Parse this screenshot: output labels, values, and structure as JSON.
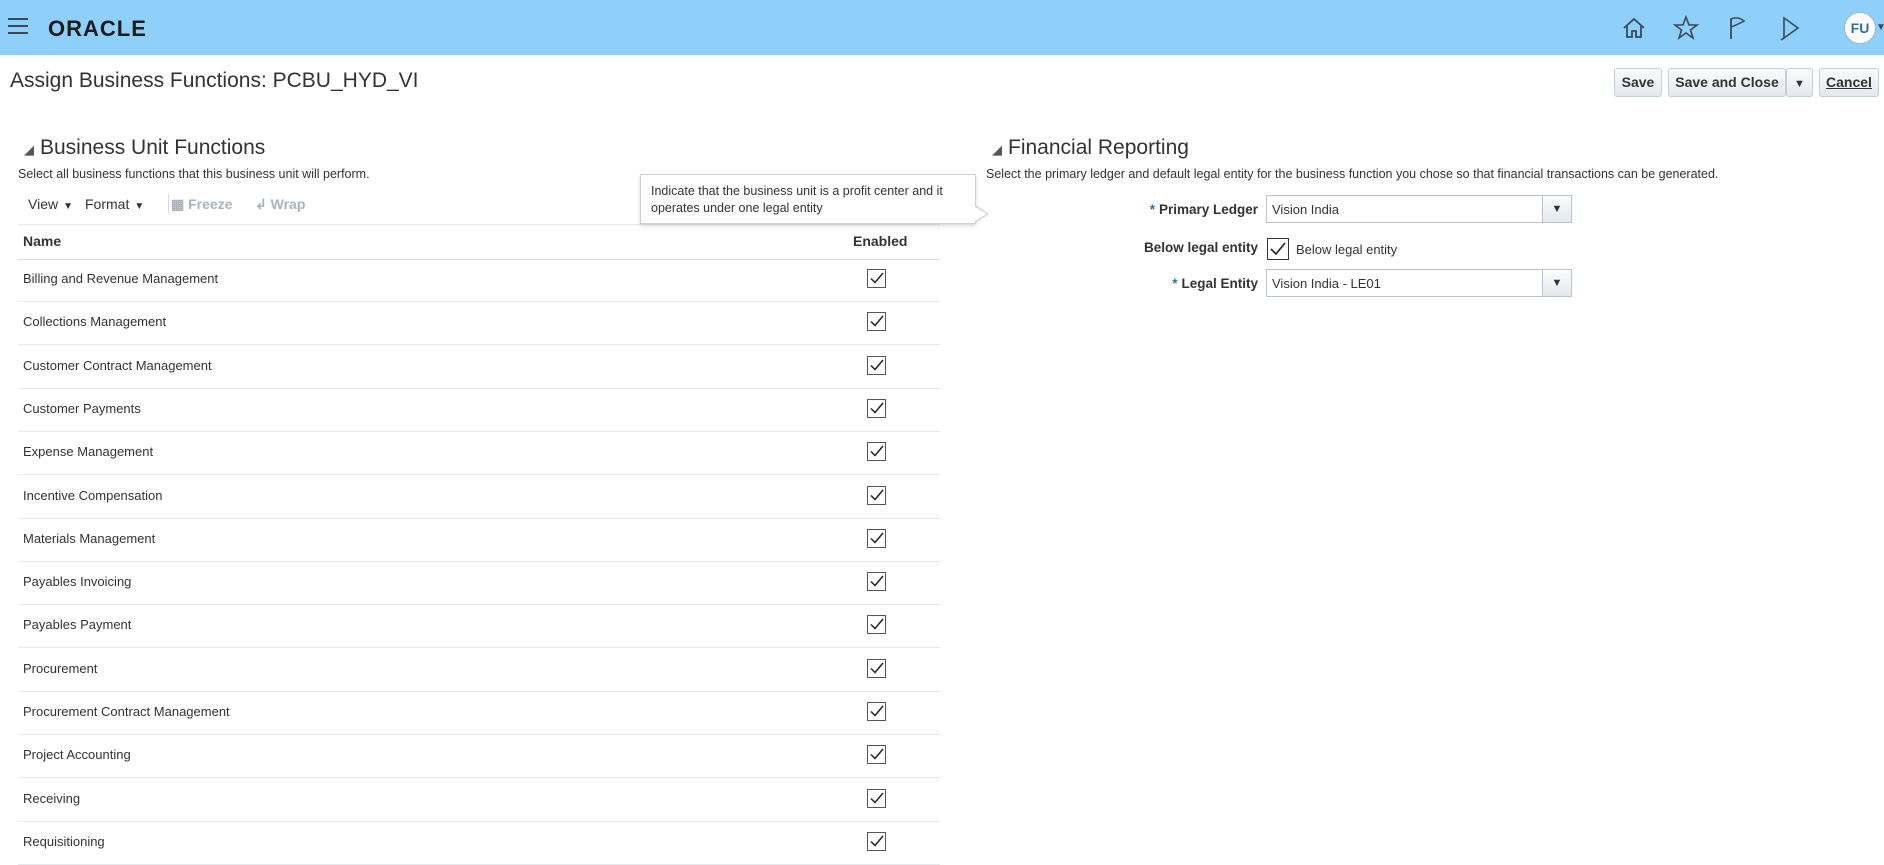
{
  "header": {
    "logo": "ORACLE",
    "icons": [
      "home-icon",
      "star-icon",
      "flag-icon",
      "play-icon"
    ],
    "avatar": "FU"
  },
  "page": {
    "title": "Assign Business Functions: PCBU_HYD_VI",
    "buttons": {
      "save": "Save",
      "save_close": "Save and Close",
      "cancel": "Cancel"
    }
  },
  "buf": {
    "heading": "Business Unit Functions",
    "description": "Select all business functions that this business unit will perform.",
    "toolbar": {
      "view": "View",
      "format": "Format",
      "freeze": "Freeze",
      "wrap": "Wrap"
    },
    "columns": {
      "name": "Name",
      "enabled": "Enabled"
    },
    "rows": [
      {
        "name": "Billing and Revenue Management",
        "enabled": true
      },
      {
        "name": "Collections Management",
        "enabled": true
      },
      {
        "name": "Customer Contract Management",
        "enabled": true
      },
      {
        "name": "Customer Payments",
        "enabled": true
      },
      {
        "name": "Expense Management",
        "enabled": true
      },
      {
        "name": "Incentive Compensation",
        "enabled": true
      },
      {
        "name": "Materials Management",
        "enabled": true
      },
      {
        "name": "Payables Invoicing",
        "enabled": true
      },
      {
        "name": "Payables Payment",
        "enabled": true
      },
      {
        "name": "Procurement",
        "enabled": true
      },
      {
        "name": "Procurement Contract Management",
        "enabled": true
      },
      {
        "name": "Project Accounting",
        "enabled": true
      },
      {
        "name": "Receiving",
        "enabled": true
      },
      {
        "name": "Requisitioning",
        "enabled": true
      }
    ],
    "tooltip": "Indicate that the business unit is a profit center and it operates under one legal entity"
  },
  "fr": {
    "heading": "Financial Reporting",
    "description": "Select the primary ledger and default legal entity for the business function you chose so that financial transactions can be generated.",
    "primary_ledger_label": "Primary Ledger",
    "primary_ledger_value": "Vision India",
    "below_label": "Below legal entity",
    "below_checkbox_label": "Below legal entity",
    "below_checked": true,
    "legal_entity_label": "Legal Entity",
    "legal_entity_value": "Vision India - LE01",
    "required_mark": "*"
  },
  "colors": {
    "topbar": "#8fd0fb",
    "required": "#2d6ea8"
  }
}
